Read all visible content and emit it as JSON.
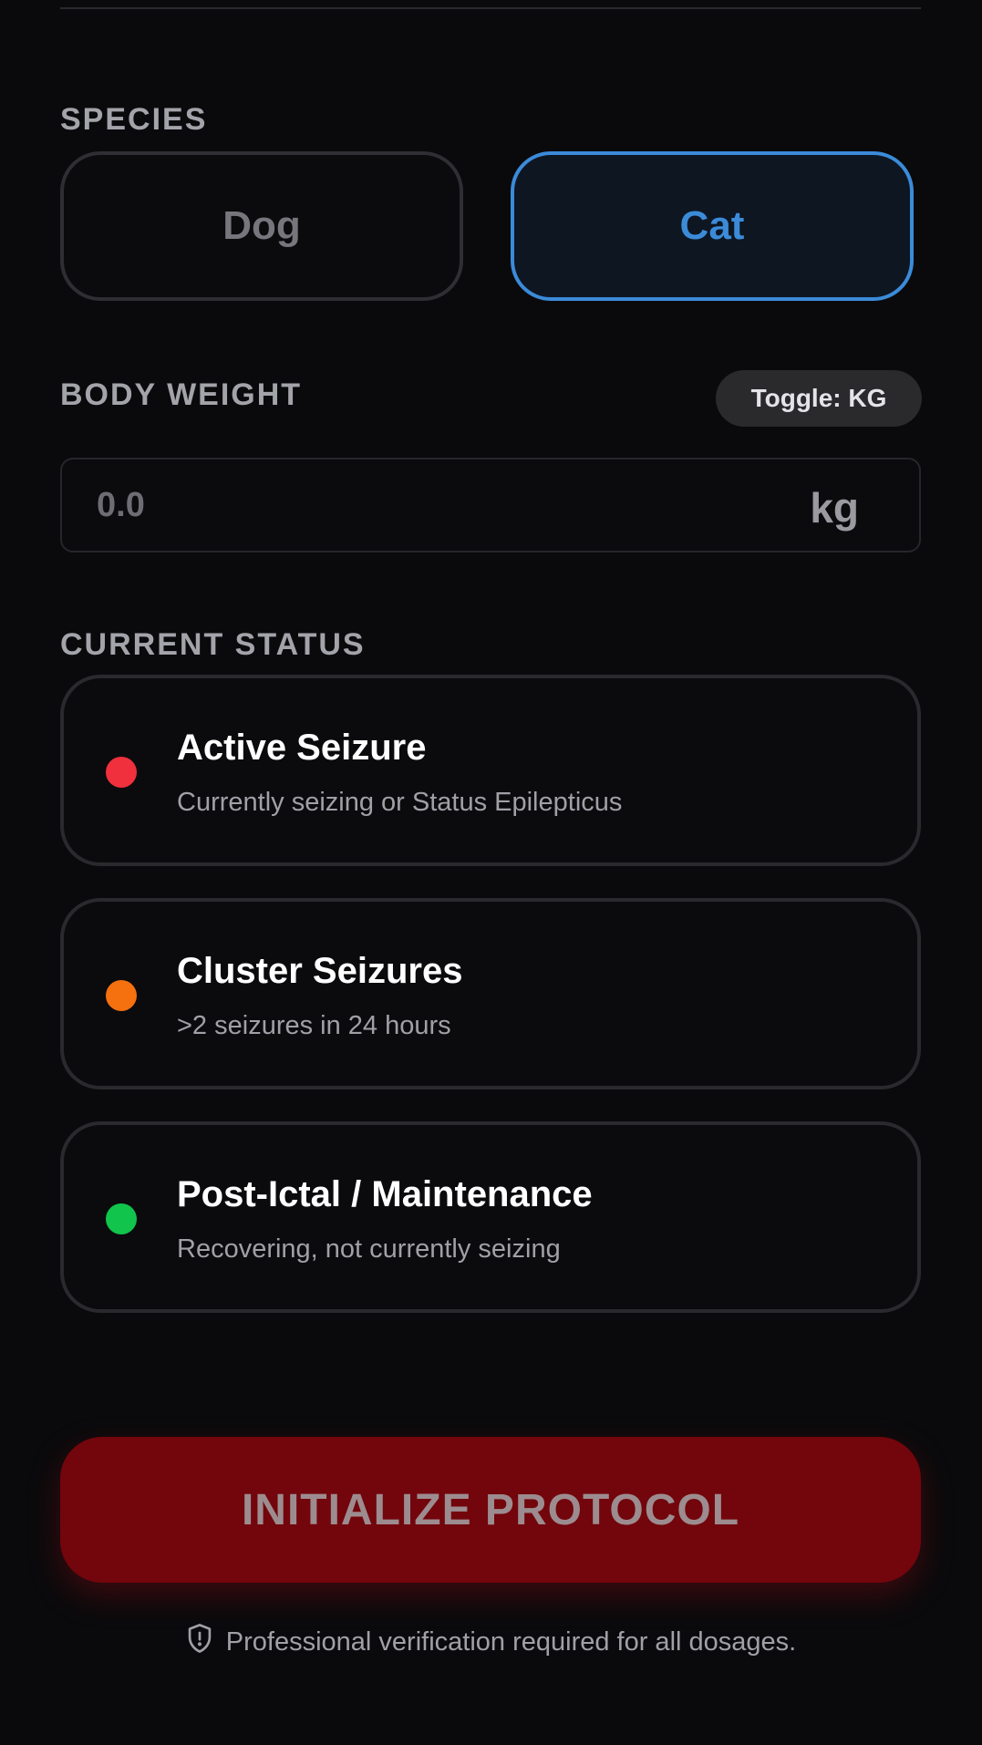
{
  "species": {
    "label": "SPECIES",
    "options": [
      {
        "label": "Dog",
        "selected": false
      },
      {
        "label": "Cat",
        "selected": true
      }
    ]
  },
  "body_weight": {
    "label": "BODY WEIGHT",
    "toggle_label": "Toggle: KG",
    "placeholder": "0.0",
    "value": "",
    "unit": "kg"
  },
  "current_status": {
    "label": "CURRENT STATUS",
    "options": [
      {
        "title": "Active Seizure",
        "description": "Currently seizing or Status Epilepticus",
        "color": "#f0303c"
      },
      {
        "title": "Cluster Seizures",
        "description": ">2 seizures in 24 hours",
        "color": "#f5700e"
      },
      {
        "title": "Post-Ictal / Maintenance",
        "description": "Recovering, not currently seizing",
        "color": "#10c44c"
      }
    ]
  },
  "action": {
    "label": "INITIALIZE PROTOCOL"
  },
  "disclaimer": {
    "icon": "shield-alert-icon",
    "text": "Professional verification required for all dosages."
  },
  "colors": {
    "accent_blue": "#3b8bd9",
    "danger_red": "#73050c",
    "background": "#0a0a0c"
  }
}
